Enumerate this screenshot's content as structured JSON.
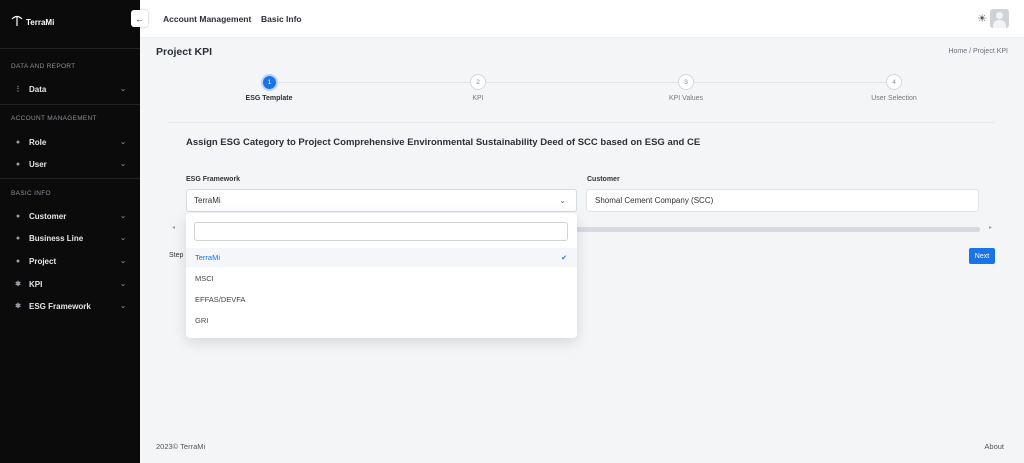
{
  "app": {
    "brand": "TerraMi"
  },
  "sidebar": {
    "sections": [
      {
        "title": "DATA AND REPORT"
      },
      {
        "title": "ACCOUNT MANAGEMENT"
      },
      {
        "title": "BASIC INFO"
      }
    ],
    "items": [
      {
        "label": "Data",
        "icon": "data-icon"
      },
      {
        "label": "Role",
        "icon": "role-icon"
      },
      {
        "label": "User",
        "icon": "user-icon"
      },
      {
        "label": "Customer",
        "icon": "customer-icon"
      },
      {
        "label": "Business Line",
        "icon": "business-line-icon"
      },
      {
        "label": "Project",
        "icon": "project-icon"
      },
      {
        "label": "KPI",
        "icon": "kpi-icon"
      },
      {
        "label": "ESG Framework",
        "icon": "esg-framework-icon"
      }
    ]
  },
  "topbar": {
    "links": [
      "Account Management",
      "Basic Info"
    ]
  },
  "page": {
    "title": "Project KPI",
    "breadcrumb": "Home  /  Project KPI"
  },
  "stepper": {
    "steps": [
      {
        "number": "1",
        "label": "ESG Template",
        "active": true
      },
      {
        "number": "2",
        "label": "KPI",
        "active": false
      },
      {
        "number": "3",
        "label": "KPI Values",
        "active": false
      },
      {
        "number": "4",
        "label": "User Selection",
        "active": false
      }
    ]
  },
  "form": {
    "heading": "Assign ESG Category to Project Comprehensive Environmental Sustainability Deed of SCC based on ESG and CE",
    "framework_label": "ESG Framework",
    "framework_value": "TerraMi",
    "customer_label": "Customer",
    "customer_value": "Shomal Cement Company (SCC)",
    "step_text": "Step",
    "next_label": "Next"
  },
  "dropdown": {
    "search_value": "",
    "options": [
      "TerraMi",
      "MSCI",
      "EFFAS/DEVFA",
      "GRI"
    ],
    "selected": "TerraMi"
  },
  "footer": {
    "left": "2023© TerraMi",
    "right": "About"
  },
  "colors": {
    "accent": "#1a73e8",
    "sidebar_bg": "#0b0b0c"
  }
}
